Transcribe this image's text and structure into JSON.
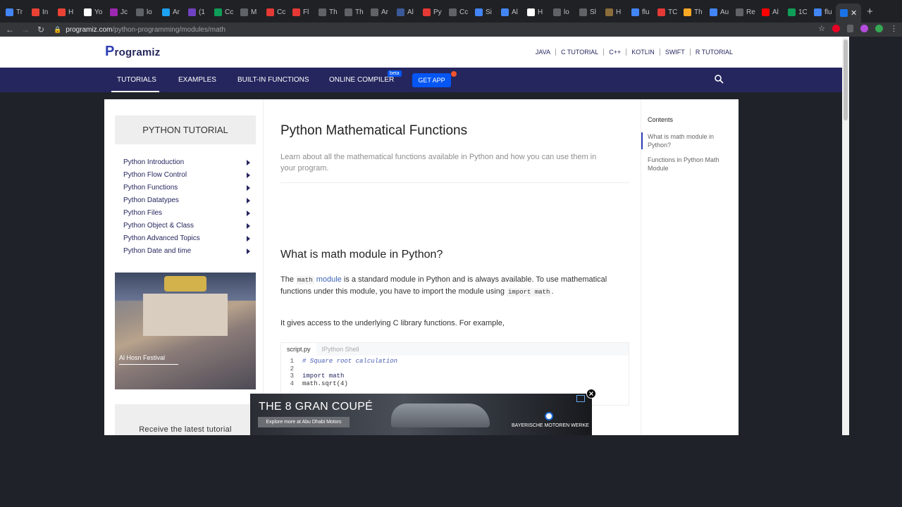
{
  "browser": {
    "tab_titles": [
      "Tr",
      "In",
      "H",
      "Yo",
      "Jc",
      "lo",
      "Ar",
      "(1",
      "Cc",
      "M",
      "Cc",
      "Fl",
      "Th",
      "Th",
      "Ar",
      "Al",
      "Py",
      "Cc",
      "Si",
      "Al",
      "H",
      "lo",
      "Sl",
      "H",
      "flu",
      "TC",
      "Th",
      "Au",
      "Re",
      "Al",
      "1C",
      "flu"
    ],
    "url_host": "programiz.com",
    "url_path": "/python-programming/modules/math",
    "new_tab_label": "+"
  },
  "site": {
    "logo_text": "rogramiz",
    "logo_p": "P",
    "top_links": [
      "JAVA",
      "C TUTORIAL",
      "C++",
      "KOTLIN",
      "SWIFT",
      "R TUTORIAL"
    ],
    "nav": {
      "tutorials": "TUTORIALS",
      "examples": "EXAMPLES",
      "builtin": "BUILT-IN FUNCTIONS",
      "compiler": "ONLINE COMPILER",
      "beta": "beta",
      "getapp": "GET APP"
    }
  },
  "sidebar": {
    "title": "PYTHON TUTORIAL",
    "items": [
      "Python Introduction",
      "Python Flow Control",
      "Python Functions",
      "Python Datatypes",
      "Python Files",
      "Python Object & Class",
      "Python Advanced Topics",
      "Python Date and time"
    ],
    "festival_caption": "Al Hosn Festival",
    "newsletter_text": "Receive the latest tutorial"
  },
  "content": {
    "title": "Python Mathematical Functions",
    "lead": "Learn about all the mathematical functions available in Python and how you can use them in your program.",
    "h2": "What is math module in Python?",
    "p1_the": "The",
    "p1_code1": "math",
    "p1_link": "module",
    "p1_rest": "is a standard module in Python and is always available. To use mathematical functions under this module, you have to import the module using",
    "p1_code2": "import math",
    "p1_end": ".",
    "p2": "It gives access to the underlying C library functions. For example,",
    "code_tabs": [
      "script.py",
      "IPython Shell"
    ],
    "code_lines": [
      {
        "n": "1",
        "text": "# Square root calculation"
      },
      {
        "n": "2",
        "text": ""
      },
      {
        "n": "3",
        "text": "import math"
      },
      {
        "n": "4",
        "text": "math.sqrt(4)"
      }
    ]
  },
  "toc": {
    "title": "Contents",
    "items": [
      "What is math module in Python?",
      "Functions in Python Math Module"
    ]
  },
  "ad": {
    "headline": "THE 8 GRAN COUPÉ",
    "cta": "Explore more at Abu Dhabi Motors",
    "brand": "BAYERISCHE MOTOREN WERKE"
  }
}
